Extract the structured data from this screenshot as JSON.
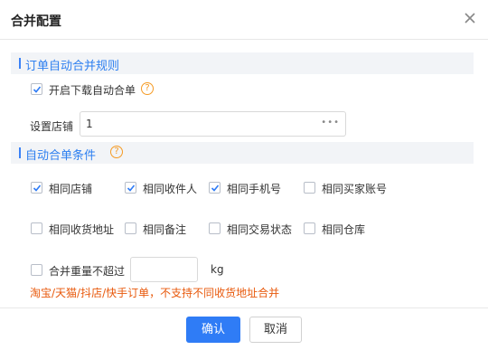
{
  "dialog": {
    "title": "合并配置"
  },
  "section1": {
    "title": "订单自动合并规则",
    "auto_merge_label": "开启下载自动合单",
    "auto_merge_checked": true,
    "shop_label": "设置店铺",
    "shop_value": "1"
  },
  "section2": {
    "title": "自动合单条件",
    "conditions": [
      {
        "label": "相同店铺",
        "checked": true
      },
      {
        "label": "相同收件人",
        "checked": true
      },
      {
        "label": "相同手机号",
        "checked": true
      },
      {
        "label": "相同买家账号",
        "checked": false
      },
      {
        "label": "相同收货地址",
        "checked": false
      },
      {
        "label": "相同备注",
        "checked": false
      },
      {
        "label": "相同交易状态",
        "checked": false
      },
      {
        "label": "相同仓库",
        "checked": false
      }
    ],
    "weight_label": "合并重量不超过",
    "weight_checked": false,
    "weight_value": "",
    "weight_unit": "kg",
    "warning": "淘宝/天猫/抖店/快手订单，不支持不同收货地址合并"
  },
  "footer": {
    "confirm_label": "确认",
    "cancel_label": "取消"
  },
  "colors": {
    "accent": "#2f7cf6",
    "section_title": "#2d7ff0",
    "help": "#f59a23",
    "warning": "#e8590c"
  },
  "icons": {
    "close": "close-icon",
    "help": "help-icon",
    "more": "ellipsis-icon",
    "check": "check-icon"
  }
}
